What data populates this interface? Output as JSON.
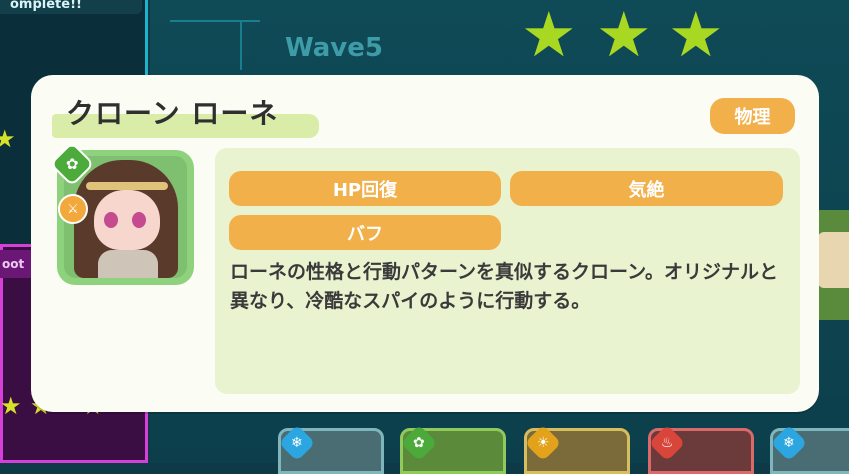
{
  "background": {
    "top_left_text": "omplete!!",
    "wave_label": "Wave5",
    "side_label": "oot",
    "stars_earned": 3,
    "colors": {
      "star": "#a9d823",
      "panel": "#0f4a57",
      "accent": "#1fb3c9"
    },
    "unit_bar": [
      {
        "element_icon": "snowflake-icon"
      },
      {
        "element_icon": "flower-icon"
      },
      {
        "element_icon": "sun-icon"
      },
      {
        "element_icon": "flame-icon"
      },
      {
        "element_icon": "snowflake-icon"
      }
    ]
  },
  "character": {
    "name": "クローン ローネ",
    "attack_type": "物理",
    "element_icon": "flower-icon",
    "role_icon": "sword-icon",
    "tags": [
      "HP回復",
      "気絶",
      "バフ"
    ],
    "description": "ローネの性格と行動パターンを真似するクローン。オリジナルと異なり、冷酷なスパイのように行動する。",
    "colors": {
      "tag": "#f2b04a",
      "card": "#fbfdf4",
      "info_panel": "#e9f3cf",
      "portrait_frame": "#8fd27e"
    }
  }
}
